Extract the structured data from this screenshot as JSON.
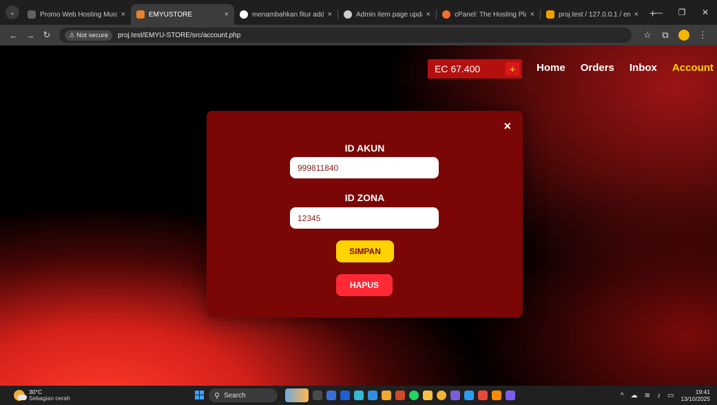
{
  "browser": {
    "tabs": [
      {
        "title": "Promo Web Hosting Mura",
        "fav_color": "#5f6368",
        "active": false
      },
      {
        "title": "EMYUSTORE",
        "fav_color": "#e8822a",
        "active": true
      },
      {
        "title": "menambahkan fitur add in",
        "fav_color": "#ffffff",
        "active": false
      },
      {
        "title": "Admin item page update",
        "fav_color": "#cfcfcf",
        "active": false
      },
      {
        "title": "cPanel: The Hosting Platfo",
        "fav_color": "#ff6c2c",
        "active": false
      },
      {
        "title": "proj.test / 127.0.0.1 / emyu",
        "fav_color": "#f0a000",
        "active": false
      }
    ],
    "not_secure_label": "Not secure",
    "url": "proj.test/EMYU-STORE/src/account.php"
  },
  "header": {
    "balance": "EC 67.400",
    "plus": "+",
    "nav": {
      "home": "Home",
      "orders": "Orders",
      "inbox": "Inbox",
      "account": "Account"
    }
  },
  "modal": {
    "close": "×",
    "id_akun_label": "ID AKUN",
    "id_akun_value": "999811840",
    "id_zona_label": "ID ZONA",
    "id_zona_value": "12345",
    "simpan": "SIMPAN",
    "hapus": "HAPUS"
  },
  "taskbar": {
    "temp": "30°C",
    "weather": "Sebagian cerah",
    "search": "Search",
    "time": "19:41",
    "date": "13/10/2025"
  },
  "colors": {
    "accent_yellow": "#ffd400",
    "modal_bg": "#7a0606",
    "hapus_red": "#ff2a35",
    "balance_bg": "#b51010"
  }
}
